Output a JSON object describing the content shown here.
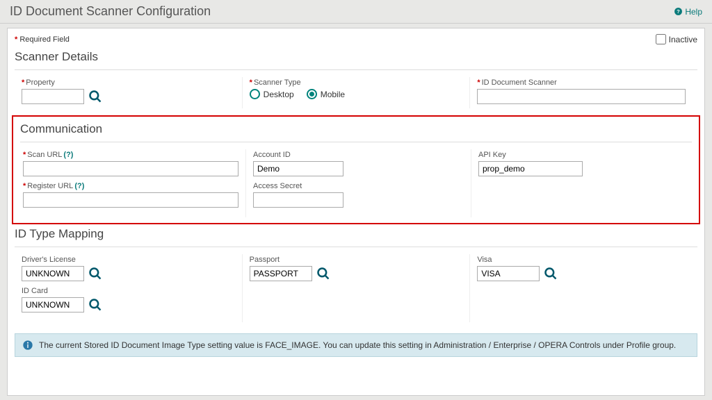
{
  "header": {
    "title": "ID Document Scanner Configuration",
    "help": "Help"
  },
  "legend": {
    "required": "Required Field",
    "inactive": "Inactive"
  },
  "details": {
    "title": "Scanner Details",
    "property_label": "Property",
    "property_value": "",
    "scanner_type_label": "Scanner Type",
    "scanner_type_options": {
      "desktop": "Desktop",
      "mobile": "Mobile"
    },
    "scanner_type_selected": "mobile",
    "id_scanner_label": "ID Document Scanner",
    "id_scanner_value": ""
  },
  "communication": {
    "title": "Communication",
    "scan_url_label": "Scan URL",
    "scan_url_value": "",
    "register_url_label": "Register URL",
    "register_url_value": "",
    "account_id_label": "Account ID",
    "account_id_value": "Demo",
    "access_secret_label": "Access Secret",
    "access_secret_value": "",
    "api_key_label": "API Key",
    "api_key_value": "prop_demo"
  },
  "mapping": {
    "title": "ID Type Mapping",
    "drivers_label": "Driver's License",
    "drivers_value": "UNKNOWN",
    "passport_label": "Passport",
    "passport_value": "PASSPORT",
    "visa_label": "Visa",
    "visa_value": "VISA",
    "idcard_label": "ID Card",
    "idcard_value": "UNKNOWN"
  },
  "info": {
    "text": "The current Stored ID Document Image Type setting value is FACE_IMAGE. You can update this setting in Administration / Enterprise / OPERA Controls under Profile group."
  }
}
